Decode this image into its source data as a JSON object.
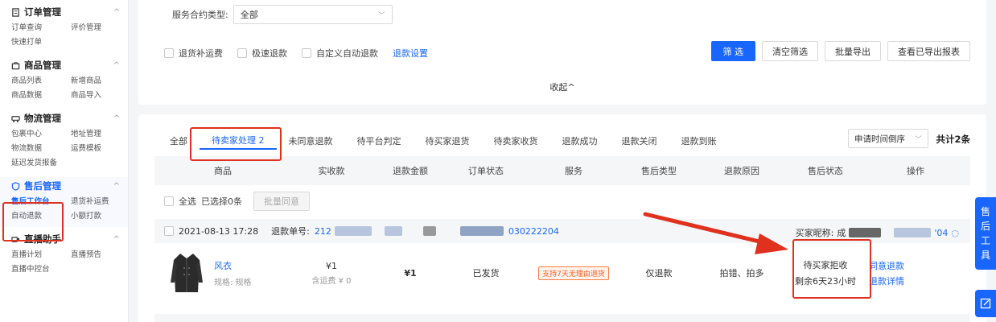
{
  "sidebar": {
    "groups": [
      {
        "title": "订单管理",
        "icon": "order-doc-icon",
        "items": [
          "订单查询",
          "评价管理",
          "快速打单"
        ]
      },
      {
        "title": "商品管理",
        "icon": "goods-bag-icon",
        "items": [
          "商品列表",
          "新增商品",
          "商品数据",
          "商品导入"
        ]
      },
      {
        "title": "物流管理",
        "icon": "truck-icon",
        "items": [
          "包裹中心",
          "地址管理",
          "物流数据",
          "运费模板",
          "延迟发货报备"
        ]
      },
      {
        "title": "售后管理",
        "icon": "shield-icon",
        "items": [
          "售后工作台",
          "退货补运费",
          "自动退款",
          "小额打款"
        ]
      },
      {
        "title": "直播助手",
        "icon": "live-camera-icon",
        "items": [
          "直播计划",
          "直播预告",
          "直播中控台"
        ]
      }
    ]
  },
  "filters": {
    "contract_label": "服务合约类型:",
    "contract_value": "全部",
    "checkboxes": [
      "退货补运费",
      "极速退款",
      "自定义自动退款"
    ],
    "refund_settings": "退款设置",
    "buttons": {
      "filter": "筛 选",
      "clear": "清空筛选",
      "export": "批量导出",
      "view_exported": "查看已导出报表"
    },
    "collapse": "收起^"
  },
  "tabs": [
    "全部",
    "待卖家处理 2",
    "未同意退款",
    "待平台判定",
    "待买家退货",
    "待卖家收货",
    "退款成功",
    "退款关闭",
    "退款到账"
  ],
  "sort_value": "申请时间倒序",
  "total": "共计2条",
  "table": {
    "headers": [
      "商品",
      "实收款",
      "退款金额",
      "订单状态",
      "服务",
      "售后类型",
      "退款原因",
      "售后状态",
      "操作"
    ],
    "select_all": "全选",
    "selected": "已选择0条",
    "bulk_agree": "批量同意"
  },
  "order": {
    "time": "2021-08-13 17:28",
    "refund_label": "退款单号:",
    "refund_prefix": "212",
    "refund_suffix": "030222204",
    "buyer_label": "买家昵称:",
    "buyer_partial": "成",
    "buyer_tail": "'04",
    "product_name": "风衣",
    "spec": "规格: 规格",
    "received": "¥1",
    "shipping": "含运费 ¥ 0",
    "refund_amount": "¥1",
    "order_status": "已发货",
    "service_badge": "支持7天无理由退货",
    "aftersale_type": "仅退款",
    "reason": "拍错、拍多",
    "status_line1": "待买家拒收",
    "status_line2": "剩余6天23小时",
    "action_agree": "同意退款",
    "action_detail": "退款详情"
  },
  "float_panel": {
    "label_chars": [
      "售",
      "后",
      "工",
      "具"
    ]
  },
  "colors": {
    "accent": "#1966ff",
    "highlight": "#e0301e",
    "badge": "#ff5a1f"
  }
}
